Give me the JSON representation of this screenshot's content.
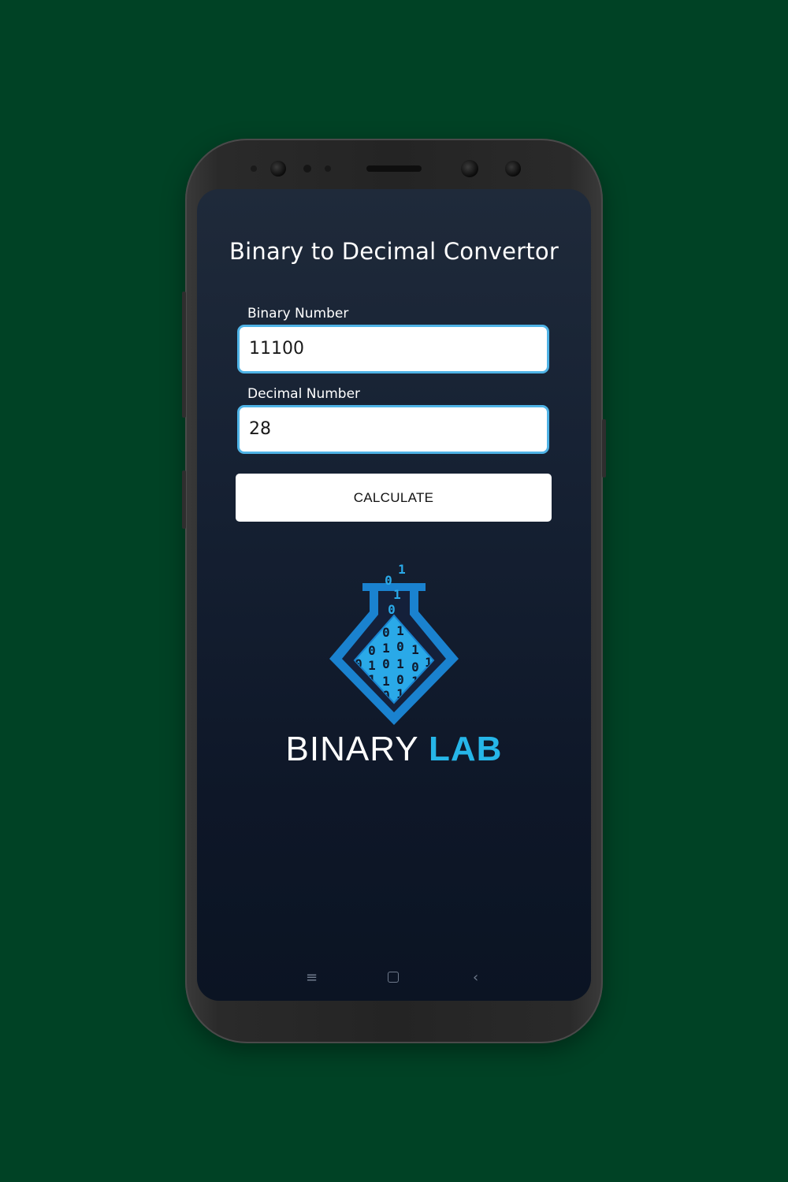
{
  "app": {
    "title": "Binary to Decimal Convertor"
  },
  "form": {
    "binary_label": "Binary Number",
    "binary_value": "11100",
    "decimal_label": "Decimal Number",
    "decimal_value": "28",
    "calculate_label": "CALCULATE"
  },
  "brand": {
    "word1": "BINARY",
    "word2": "LAB"
  },
  "navbar": {
    "menu_icon": "≡",
    "back_icon": "‹"
  },
  "colors": {
    "background": "#004225",
    "accent": "#26b6e8",
    "field_border": "#4fb3e6"
  }
}
